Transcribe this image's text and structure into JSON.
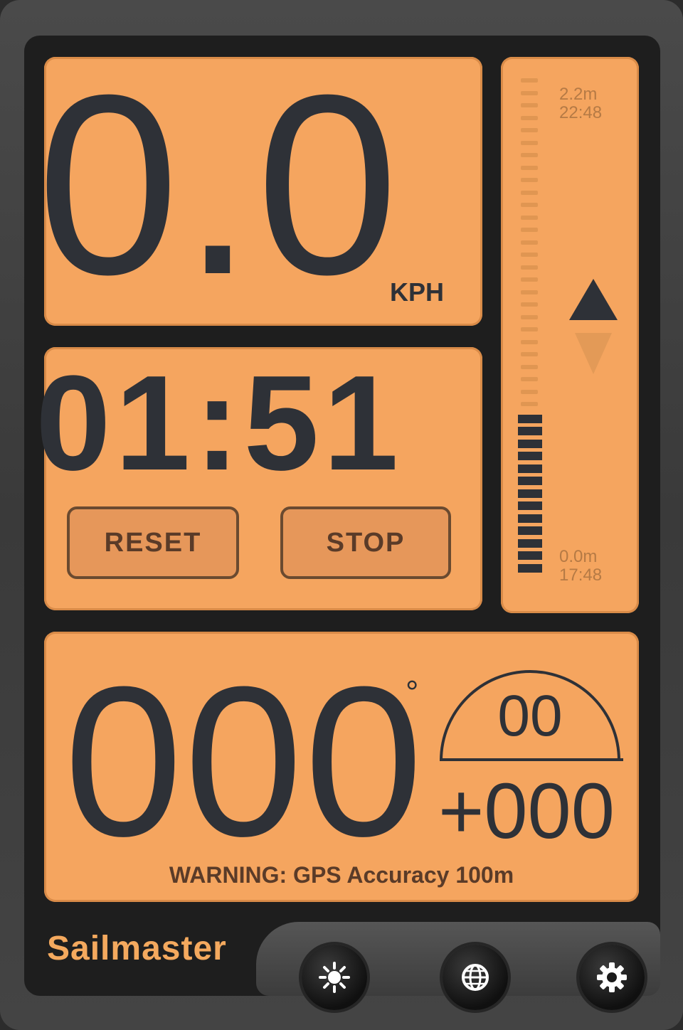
{
  "speed": {
    "value": "0.0",
    "unit": "KPH"
  },
  "timer": {
    "value": "01:51",
    "reset_label": "RESET",
    "stop_label": "STOP"
  },
  "gauge": {
    "top_label": "2.2m\n22:48",
    "bottom_label": "0.0m\n17:48",
    "filled_ticks": 13,
    "total_ticks": 40
  },
  "heading": {
    "value": "000",
    "degree_symbol": "°",
    "wind_value": "00",
    "offset_value": "+000",
    "warning": "WARNING: GPS Accuracy 100m"
  },
  "footer": {
    "brand": "Sailmaster",
    "buttons": [
      {
        "icon": "sun-icon"
      },
      {
        "icon": "globe-icon"
      },
      {
        "icon": "gear-icon"
      }
    ]
  },
  "colors": {
    "lcd": "#f5a55f",
    "segment": "#2e3137",
    "brand": "#f4a95e"
  }
}
